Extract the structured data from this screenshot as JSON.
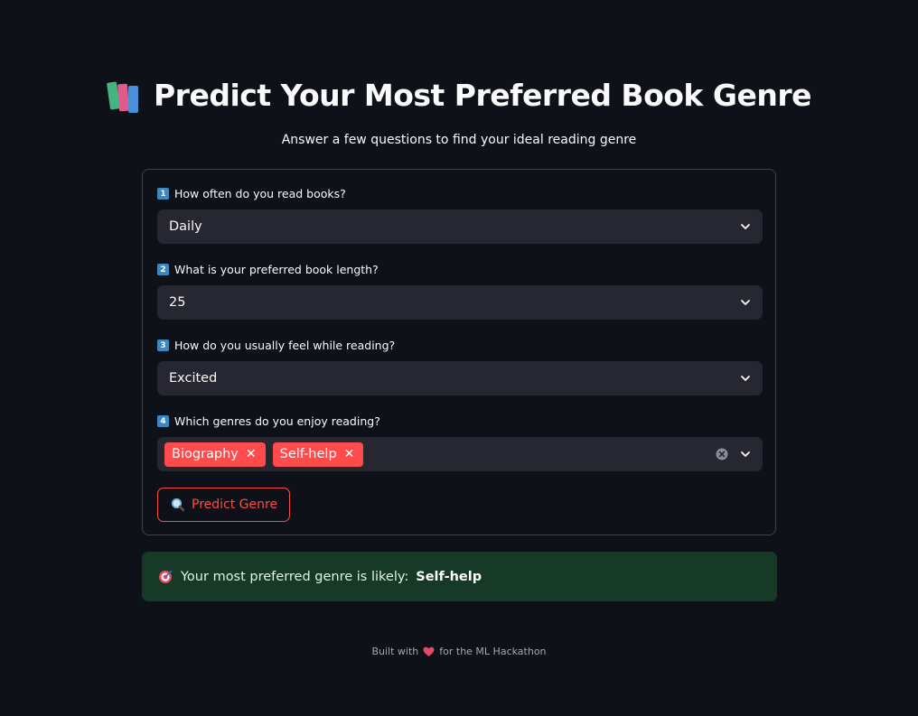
{
  "header": {
    "title": "Predict Your Most Preferred Book Genre",
    "subtitle": "Answer a few questions to find your ideal reading genre"
  },
  "form": {
    "questions": [
      {
        "number": "1",
        "label": "How often do you read books?",
        "value": "Daily"
      },
      {
        "number": "2",
        "label": "What is your preferred book length?",
        "value": "25"
      },
      {
        "number": "3",
        "label": "How do you usually feel while reading?",
        "value": "Excited"
      },
      {
        "number": "4",
        "label": "Which genres do you enjoy reading?",
        "selected": [
          "Biography",
          "Self-help"
        ]
      }
    ],
    "predict_button": "Predict Genre"
  },
  "result": {
    "prefix": "Your most preferred genre is likely:",
    "genre": "Self-help"
  },
  "footer": {
    "before": "Built with",
    "after": "for the ML Hackathon"
  },
  "colors": {
    "background": "#0e1117",
    "input_bg": "#262730",
    "accent": "#ff4b4b",
    "success_bg": "#173928"
  }
}
